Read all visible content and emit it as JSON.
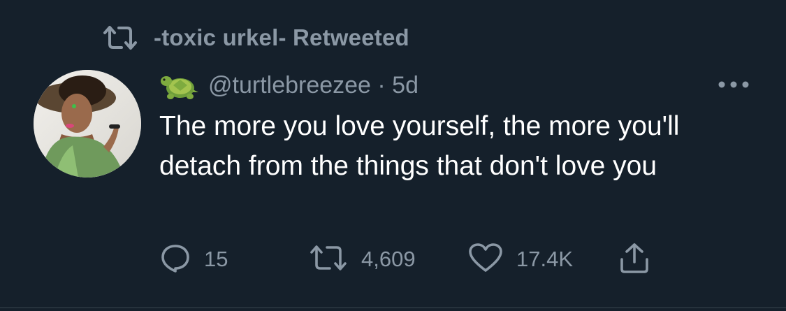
{
  "retweet_banner": {
    "icon": "retweet-icon",
    "text": "-toxic urkel- Retweeted"
  },
  "tweet": {
    "avatar": "profile-photo-avatar",
    "emoji": "turtle-emoji",
    "handle_and_time": "@turtlebreezee · 5d",
    "text": "The more you love yourself, the more you'll detach from the things that don't love you",
    "more_icon": "more-options-icon"
  },
  "actions": {
    "reply": {
      "icon": "reply-icon",
      "count": "15"
    },
    "retweet": {
      "icon": "retweet-icon",
      "count": "4,609"
    },
    "like": {
      "icon": "heart-icon",
      "count": "17.4K"
    },
    "share": {
      "icon": "share-icon"
    }
  },
  "colors": {
    "background": "#15202b",
    "secondary_text": "#8b98a5",
    "primary_text": "#ffffff"
  }
}
